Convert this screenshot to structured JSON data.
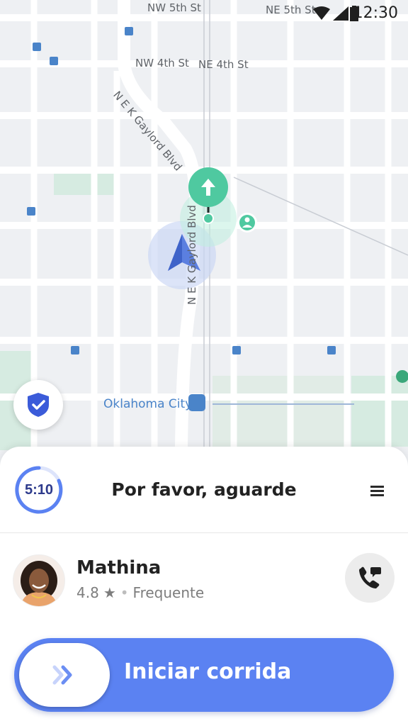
{
  "status_bar": {
    "time": "12:30"
  },
  "map": {
    "labels": {
      "nw5": "NW 5th St",
      "ne5": "NE 5th St",
      "nw4": "NW 4th St",
      "ne4": "NE 4th St",
      "gaylord1": "N E K Gaylord Blvd",
      "gaylord2": "N E K Gaylord Blvd",
      "city": "Oklahoma City"
    }
  },
  "trip_panel": {
    "timer": "5:10",
    "title": "Por favor, aguarde"
  },
  "passenger": {
    "name": "Mathina",
    "rating": "4.8",
    "tag": "Frequente"
  },
  "action": {
    "label": "Iniciar corrida"
  },
  "colors": {
    "accent": "#5b82f2",
    "pickup": "#4fc9a0",
    "navy": "#2d3a8c"
  },
  "icons": [
    "shield-check-icon",
    "menu-icon",
    "phone-icon",
    "chevron-double-right-icon",
    "navigation-arrow-icon",
    "person-pin-icon",
    "transit-icon"
  ]
}
